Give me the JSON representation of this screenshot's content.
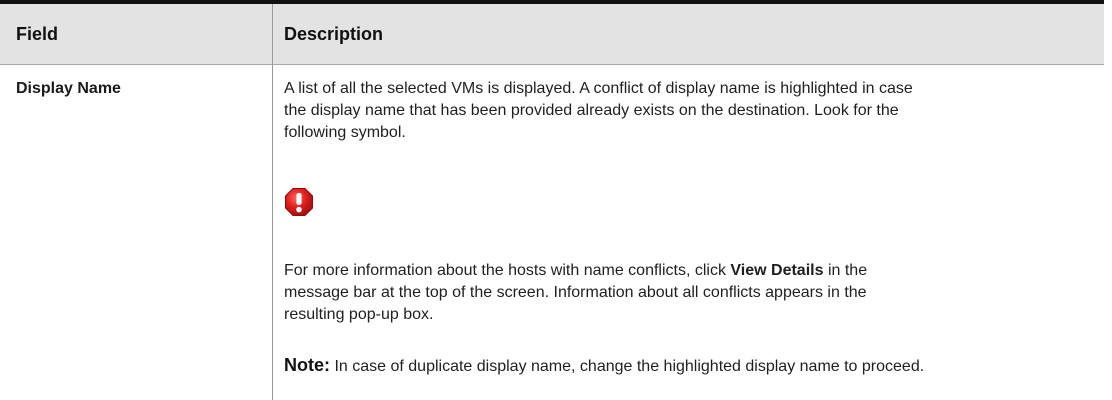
{
  "table": {
    "headers": {
      "field": "Field",
      "description": "Description"
    },
    "rows": [
      {
        "field": "Display Name",
        "description": {
          "paragraph1_lines": [
            "A list of all the selected VMs is displayed. A conflict of display name is highlighted in case",
            "the display name that has been provided already exists on the destination. Look for the",
            "following symbol."
          ],
          "symbol_icon": "red-exclamation-alert-icon",
          "paragraph2": {
            "line1_before": "For more information about the hosts with name conflicts, click ",
            "line1_bold": "View Details",
            "line1_after": " in the",
            "line2": "message bar at the top of the screen. Information about all conflicts appears in the",
            "line3": "resulting pop-up box."
          },
          "note": {
            "label": "Note:",
            "text": " In case of duplicate display name, change the highlighted display name to proceed."
          }
        }
      }
    ]
  },
  "colors": {
    "header_background": "#e3e3e3",
    "top_rule": "#111111",
    "divider": "#9a9a9a",
    "alert_red": "#d81e1e"
  }
}
